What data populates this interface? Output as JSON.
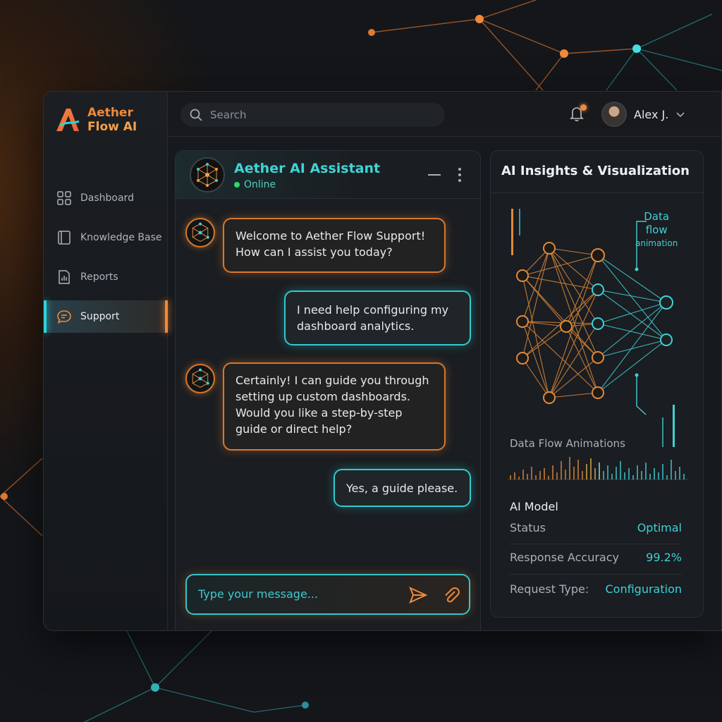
{
  "brand": {
    "line1": "Aether",
    "line2": "Flow AI"
  },
  "search": {
    "placeholder": "Search"
  },
  "user": {
    "name": "Alex J."
  },
  "sidebar": {
    "items": [
      {
        "label": "Dashboard",
        "icon": "grid-icon"
      },
      {
        "label": "Knowledge Base",
        "icon": "book-icon"
      },
      {
        "label": "Reports",
        "icon": "report-icon"
      },
      {
        "label": "Support",
        "icon": "chat-bubble-icon",
        "active": true
      }
    ]
  },
  "chat": {
    "title": "Aether AI Assistant",
    "status": "Online",
    "messages": [
      {
        "from": "bot",
        "text": "Welcome to Aether Flow Support! How can I assist you today?"
      },
      {
        "from": "user",
        "text": "I need help configuring my dashboard analytics."
      },
      {
        "from": "bot",
        "text": "Certainly! I can guide you through setting up custom dashboards. Would you like a step-by-step guide or direct help?"
      },
      {
        "from": "user",
        "text": "Yes, a guide please."
      }
    ],
    "input_placeholder": "Type your message..."
  },
  "insights": {
    "title": "AI Insights & Visualization",
    "flow_label": {
      "line1": "Data",
      "line2": "flow",
      "line3": "animation"
    },
    "animations_label": "Data Flow Animations",
    "model_title": "AI Model",
    "status_key": "Status",
    "status_value": "Optimal",
    "accuracy_key": "Response Accuracy",
    "accuracy_value": "99.2%",
    "request_key": "Request Type:",
    "request_value": "Configuration"
  },
  "colors": {
    "accent_cyan": "#2fd3d8",
    "accent_orange": "#f08a3a",
    "online_green": "#2ed86a"
  }
}
